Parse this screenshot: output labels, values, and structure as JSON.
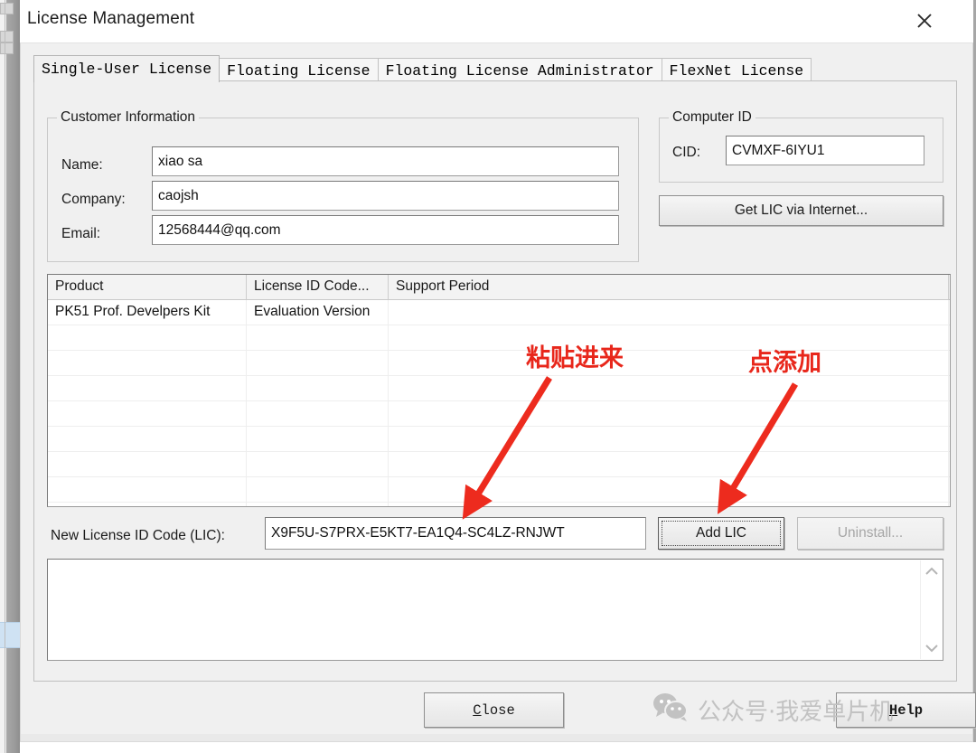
{
  "window": {
    "title": "License Management",
    "close_icon": "close-icon"
  },
  "tabs": [
    {
      "label": "Single-User License",
      "active": true
    },
    {
      "label": "Floating License",
      "active": false
    },
    {
      "label": "Floating License Administrator",
      "active": false
    },
    {
      "label": "FlexNet License",
      "active": false
    }
  ],
  "customer_information": {
    "legend": "Customer Information",
    "fields": [
      {
        "label": "Name:",
        "value": "xiao sa"
      },
      {
        "label": "Company:",
        "value": "caojsh"
      },
      {
        "label": "Email:",
        "value": "12568444@qq.com"
      }
    ]
  },
  "computer_id": {
    "legend": "Computer ID",
    "cid_label": "CID:",
    "cid_value": "CVMXF-6IYU1",
    "get_lic_button": "Get LIC via Internet..."
  },
  "license_table": {
    "columns": [
      "Product",
      "License ID Code...",
      "Support Period"
    ],
    "rows": [
      [
        "PK51 Prof. Develpers Kit",
        "Evaluation Version",
        ""
      ]
    ],
    "empty_row_count": 8
  },
  "new_lic": {
    "label": "New License ID Code (LIC):",
    "value": "X9F5U-S7PRX-E5KT7-EA1Q4-SC4LZ-RNJWT",
    "add_button": "Add LIC",
    "uninstall_button": "Uninstall..."
  },
  "log": {
    "text": "",
    "scroll_up_icon": "chevron-up-icon",
    "scroll_down_icon": "chevron-down-icon"
  },
  "footer": {
    "close_button": "Close",
    "help_button": "Help"
  },
  "annotations": [
    {
      "text": "粘贴进来",
      "name": "annotation-paste-here"
    },
    {
      "text": "点添加",
      "name": "annotation-click-add"
    }
  ],
  "watermark": {
    "icon": "wechat-icon",
    "text": "公众号·我爱单片机"
  },
  "colors": {
    "annotation_red": "#e8271b",
    "dialog_face": "#f0f0f0",
    "watermark_gray": "#c2c2c2"
  }
}
